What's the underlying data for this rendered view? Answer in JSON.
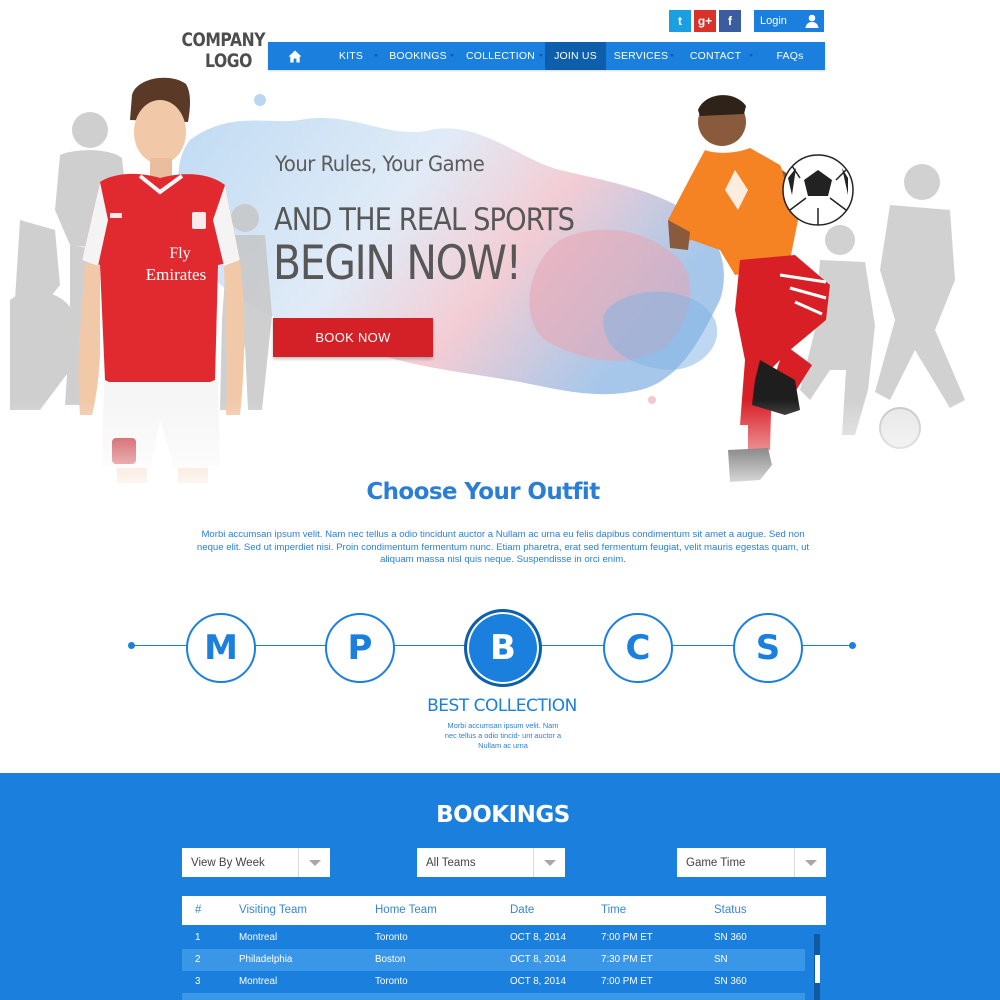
{
  "header": {
    "logo_line1": "COMPANY",
    "logo_line2": "LOGO",
    "social": [
      {
        "icon": "twitter-icon",
        "glyph": "t"
      },
      {
        "icon": "google-plus-icon",
        "glyph": "g+"
      },
      {
        "icon": "facebook-icon",
        "glyph": "f"
      }
    ],
    "login_label": "Login"
  },
  "nav": {
    "home_icon": "home-icon",
    "items": [
      {
        "label": "KITS"
      },
      {
        "label": "BOOKINGS"
      },
      {
        "label": "COLLECTION"
      },
      {
        "label": "JOIN US"
      },
      {
        "label": "SERVICES"
      },
      {
        "label": "CONTACT"
      },
      {
        "label": "FAQs"
      }
    ],
    "active": "JOIN US"
  },
  "hero": {
    "subtitle": "Your Rules, Your Game",
    "headline_line1": "AND THE REAL SPORTS",
    "headline_line2": "BEGIN NOW!",
    "cta_label": "BOOK NOW",
    "jersey_text_line1": "Fly",
    "jersey_text_line2": "Emirates"
  },
  "outfit": {
    "title": "Choose Your Outfit",
    "body": "Morbi accumsan ipsum velit. Nam nec tellus a odio tincidunt auctor a Nullam ac urna eu felis dapibus condimentum sit amet a augue. Sed non neque elit. Sed ut imperdiet nisi. Proin condimentum fermentum nunc. Etiam pharetra, erat sed fermentum feugiat, velit mauris egestas quam, ut aliquam massa nisl quis neque. Suspendisse in orci enim.",
    "steps": [
      {
        "letter": "M"
      },
      {
        "letter": "P"
      },
      {
        "letter": "B"
      },
      {
        "letter": "C"
      },
      {
        "letter": "S"
      }
    ],
    "active_step": "B",
    "collection_title": "BEST COLLECTION",
    "collection_text": "Morbi accumsan ipsum velit. Nam nec tellus a odio tincid- unt auctor a Nullam ac urna"
  },
  "bookings": {
    "title": "BOOKINGS",
    "filters": [
      {
        "value": "View By Week"
      },
      {
        "value": "All Teams"
      },
      {
        "value": "Game Time"
      }
    ],
    "columns": [
      "#",
      "Visiting Team",
      "Home Team",
      "Date",
      "Time",
      "Status"
    ],
    "rows": [
      [
        "1",
        "Montreal",
        "Toronto",
        "OCT 8, 2014",
        "7:00 PM ET",
        "SN 360"
      ],
      [
        "2",
        "Philadelphia",
        "Boston",
        "OCT 8, 2014",
        "7:30 PM ET",
        "SN"
      ],
      [
        "3",
        "Montreal",
        "Toronto",
        "OCT 8, 2014",
        "7:00 PM ET",
        "SN 360"
      ]
    ]
  },
  "colors": {
    "brand_blue": "#1a7fdd",
    "nav_active": "#0e5fab",
    "cta_red": "#d42027",
    "row_alt": "#3a97e8"
  }
}
